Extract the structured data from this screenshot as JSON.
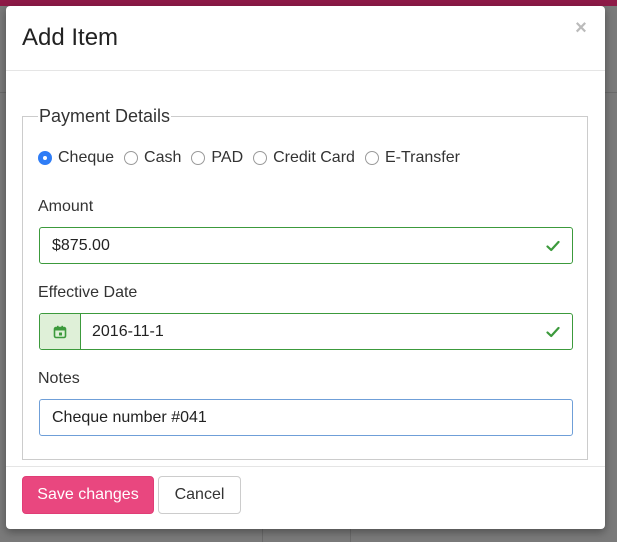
{
  "modal": {
    "title": "Add Item",
    "close_glyph": "×",
    "fieldset_legend": "Payment Details",
    "payment_methods": [
      {
        "label": "Cheque",
        "checked": true
      },
      {
        "label": "Cash",
        "checked": false
      },
      {
        "label": "PAD",
        "checked": false
      },
      {
        "label": "Credit Card",
        "checked": false
      },
      {
        "label": "E-Transfer",
        "checked": false
      }
    ],
    "amount": {
      "label": "Amount",
      "value": "$875.00",
      "valid": true
    },
    "effective_date": {
      "label": "Effective Date",
      "value": "2016-11-1",
      "valid": true
    },
    "notes": {
      "label": "Notes",
      "value": "Cheque number #041"
    },
    "buttons": {
      "save": "Save changes",
      "cancel": "Cancel"
    }
  },
  "icons": {
    "close": "close-icon",
    "valid": "checkmark-icon",
    "date": "calendar-icon"
  },
  "colors": {
    "primary_button": "#e9477f",
    "valid_border": "#3c9a3c",
    "radio_checked": "#2f7df6",
    "addon_bg": "#dff0d8"
  }
}
